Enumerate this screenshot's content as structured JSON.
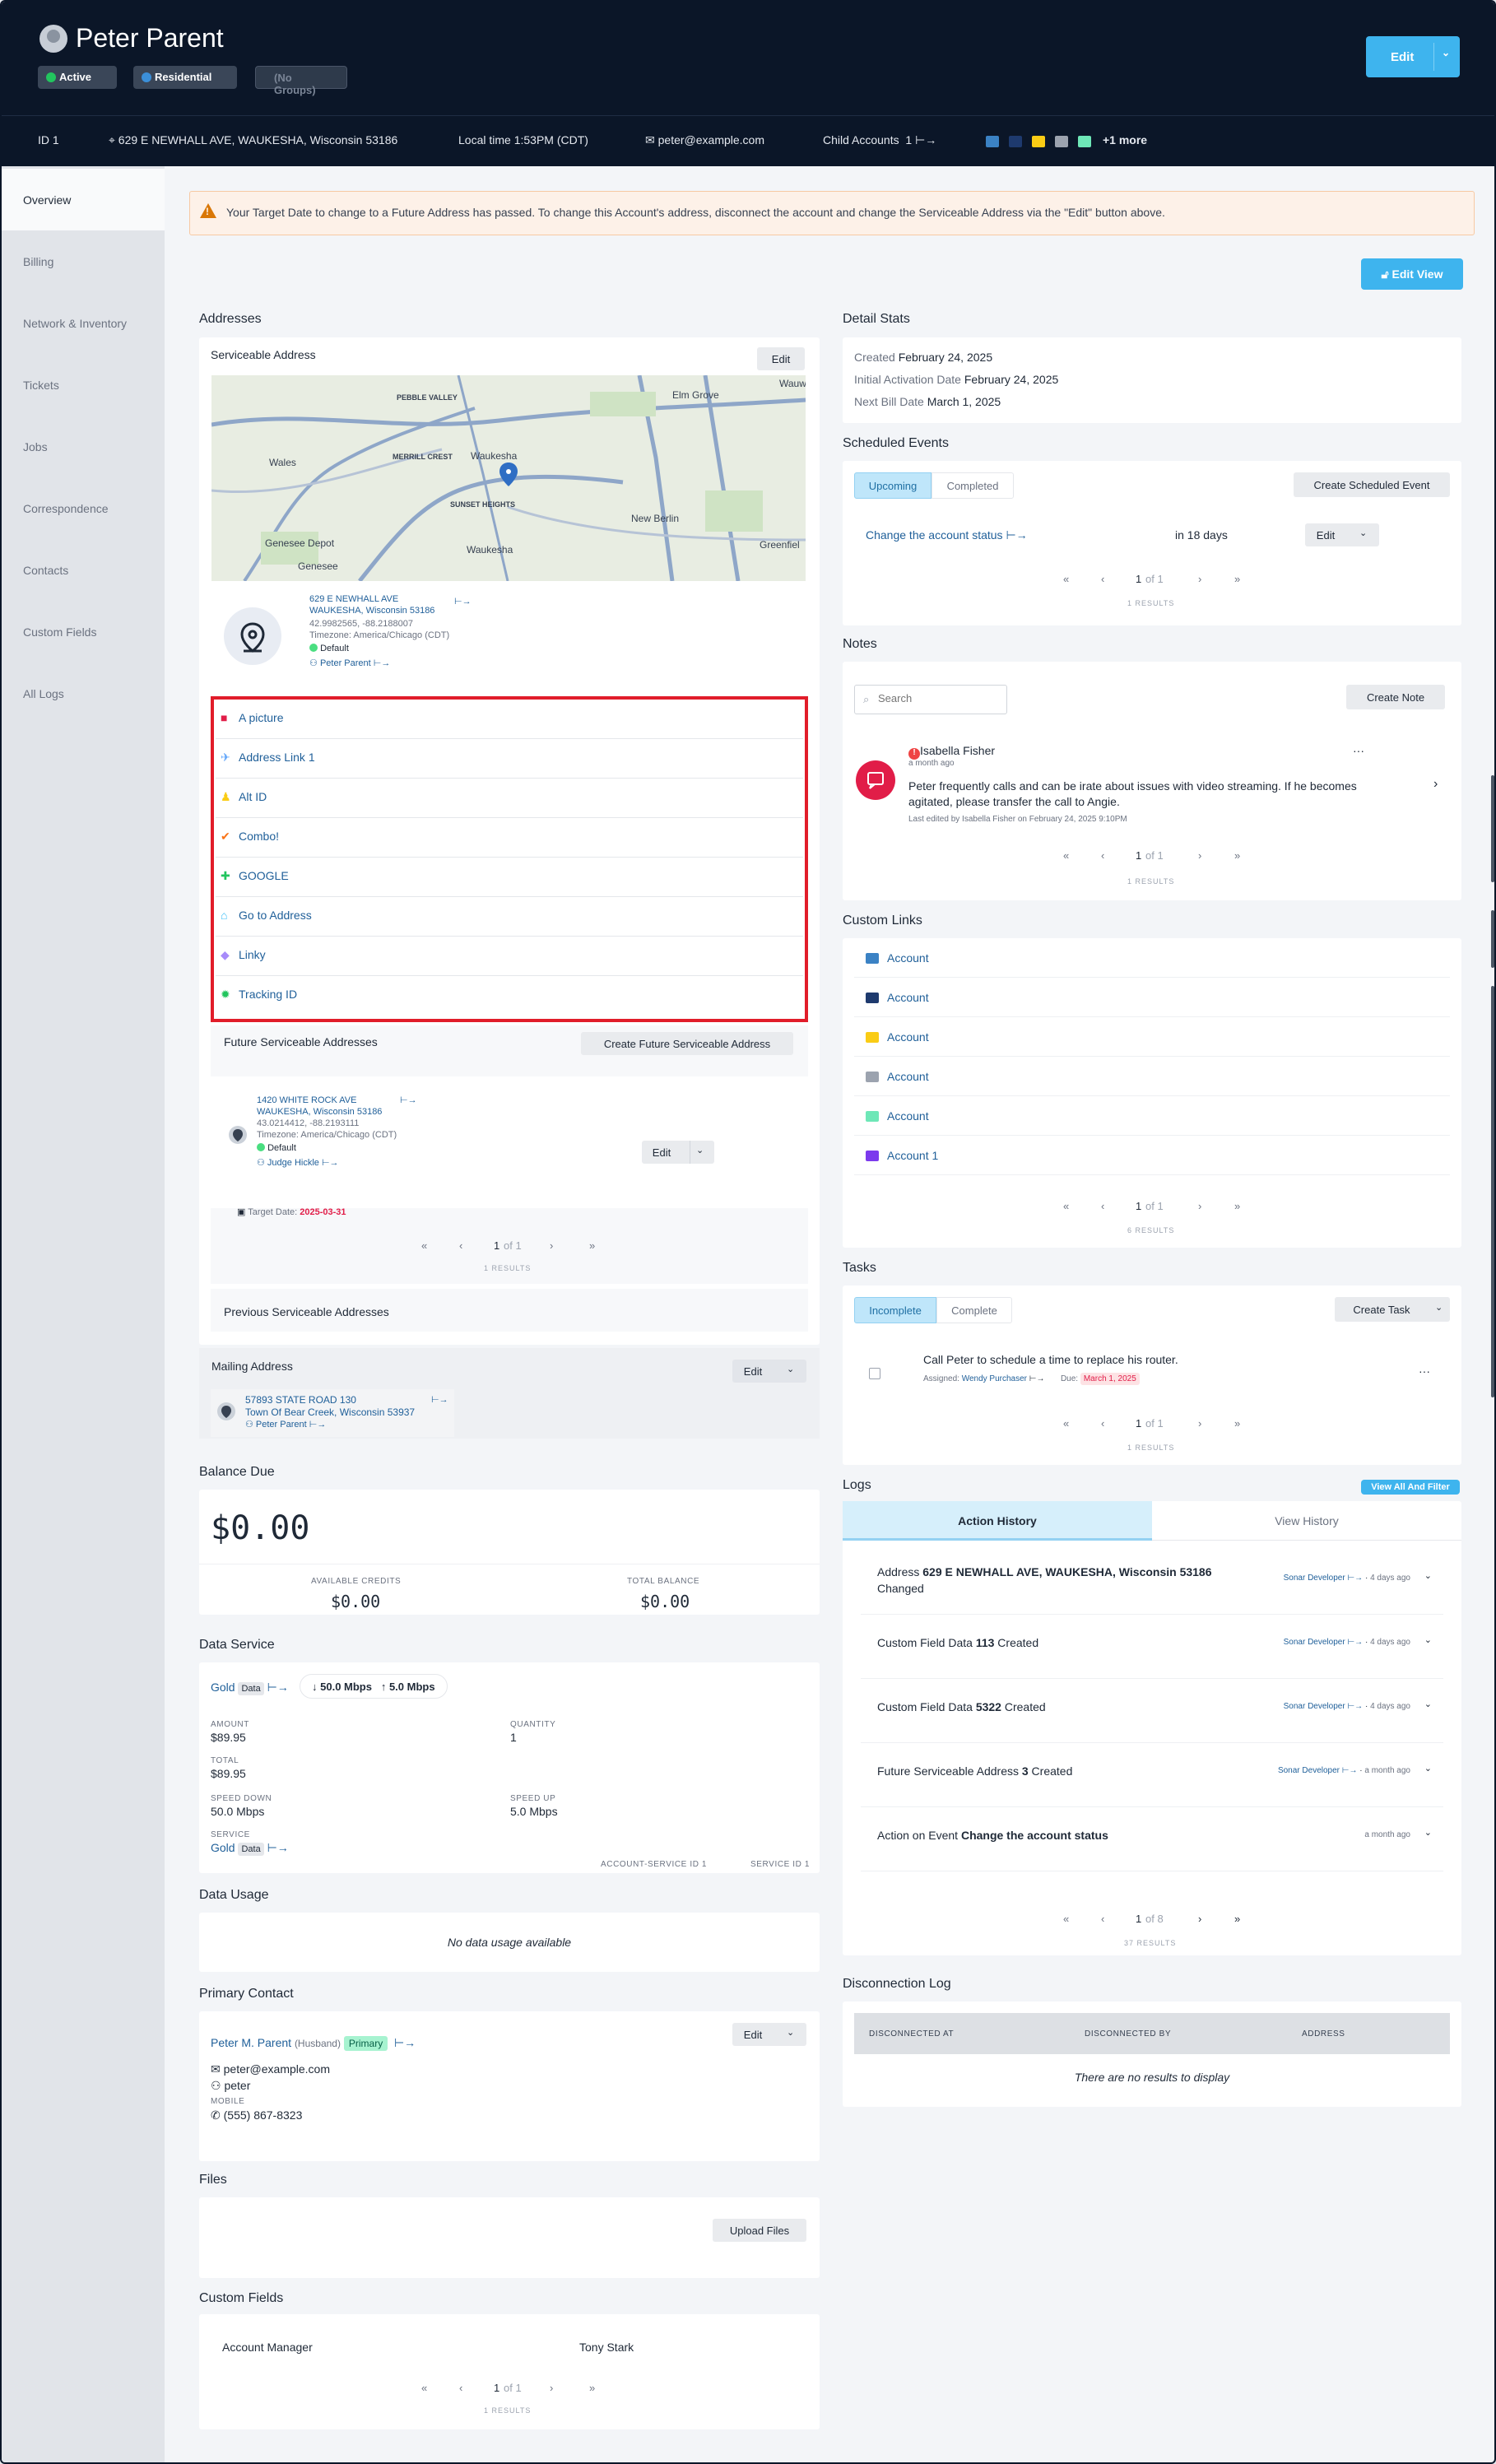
{
  "header": {
    "name": "Peter Parent",
    "pills": [
      "Active",
      "Residential",
      "(No Groups)"
    ],
    "edit_label": "Edit"
  },
  "infobar": {
    "id": "ID 1",
    "address": "629 E NEWHALL AVE, WAUKESHA, Wisconsin 53186",
    "local_time": "Local time 1:53PM (CDT)",
    "email": "peter@example.com",
    "child_accounts": "Child Accounts",
    "child_count": "1",
    "more": "+1 more"
  },
  "sidebar": {
    "items": [
      "Overview",
      "Billing",
      "Network & Inventory",
      "Tickets",
      "Jobs",
      "Correspondence",
      "Contacts",
      "Custom Fields",
      "All Logs"
    ]
  },
  "alert": {
    "text": "Your Target Date to change to a Future Address has passed. To change this Account's address, disconnect the account and change the Serviceable Address via the \"Edit\" button above."
  },
  "edit_view": "Edit View",
  "addresses": {
    "title": "Addresses",
    "serviceable": "Serviceable Address",
    "edit": "Edit",
    "map_labels": [
      "PEBBLE VALLEY",
      "Elm Grove",
      "Wauwat",
      "MERRILL CREST",
      "Waukesha",
      "Wales",
      "SUNSET HEIGHTS",
      "New Berlin",
      "Genesee Depot",
      "Waukesha",
      "Genesee",
      "Greenfiel"
    ],
    "line1": "629 E NEWHALL AVE",
    "line2": "WAUKESHA, Wisconsin 53186",
    "coords": "42.9982565, -88.2188007",
    "tz": "Timezone: America/Chicago (CDT)",
    "default": "Default",
    "contact": "Peter Parent",
    "links": [
      "A picture",
      "Address Link 1",
      "Alt ID",
      "Combo!",
      "GOOGLE",
      "Go to Address",
      "Linky",
      "Tracking ID"
    ],
    "future_title": "Future Serviceable Addresses",
    "create_future": "Create Future Serviceable Address",
    "future": {
      "line1": "1420 WHITE ROCK AVE",
      "line2": "WAUKESHA, Wisconsin 53186",
      "coords": "43.0214412, -88.2193111",
      "tz": "Timezone: America/Chicago (CDT)",
      "default": "Default",
      "contact": "Judge Hickle",
      "target_label": "Target Date:",
      "target": "2025-03-31",
      "edit": "Edit"
    },
    "pager": {
      "page": "1",
      "of": "of 1",
      "results": "1 RESULTS"
    },
    "previous": "Previous Serviceable Addresses",
    "mailing": "Mailing Address",
    "mailing_line1": "57893 STATE ROAD 130",
    "mailing_line2": "Town Of Bear Creek, Wisconsin 53937",
    "mailing_contact": "Peter Parent"
  },
  "balance": {
    "title": "Balance Due",
    "amount": "$0.00",
    "available_label": "AVAILABLE CREDITS",
    "available": "$0.00",
    "total_label": "TOTAL BALANCE",
    "total": "$0.00"
  },
  "data_service": {
    "title": "Data Service",
    "plan": "Gold",
    "tag": "Data",
    "down": "50.0 Mbps",
    "up": "5.0 Mbps",
    "amount_label": "AMOUNT",
    "amount": "$89.95",
    "qty_label": "QUANTITY",
    "qty": "1",
    "total_label": "TOTAL",
    "total": "$89.95",
    "sd_label": "SPEED DOWN",
    "sd": "50.0 Mbps",
    "su_label": "SPEED UP",
    "su": "5.0 Mbps",
    "service_label": "SERVICE",
    "service": "Gold",
    "acct_service_id": "ACCOUNT-SERVICE ID 1",
    "service_id": "SERVICE ID 1"
  },
  "data_usage": {
    "title": "Data Usage",
    "empty": "No data usage available"
  },
  "primary_contact": {
    "title": "Primary Contact",
    "name": "Peter M. Parent",
    "relation": "(Husband)",
    "badge": "Primary",
    "edit": "Edit",
    "email": "peter@example.com",
    "username": "peter",
    "mobile_label": "MOBILE",
    "mobile": "(555) 867-8323"
  },
  "files": {
    "title": "Files",
    "upload": "Upload Files"
  },
  "custom_fields": {
    "title": "Custom Fields",
    "key": "Account Manager",
    "value": "Tony Stark",
    "page": "1",
    "of": "of 1",
    "results": "1 RESULTS"
  },
  "detail_stats": {
    "title": "Detail Stats",
    "created_label": "Created",
    "created": "February 24, 2025",
    "activation_label": "Initial Activation Date",
    "activation": "February 24, 2025",
    "bill_label": "Next Bill Date",
    "bill": "March 1, 2025"
  },
  "scheduled": {
    "title": "Scheduled Events",
    "tabs": [
      "Upcoming",
      "Completed"
    ],
    "create": "Create Scheduled Event",
    "event": "Change the account status",
    "when": "in 18 days",
    "edit": "Edit",
    "page": "1",
    "of": "of 1",
    "results": "1 RESULTS"
  },
  "notes": {
    "title": "Notes",
    "search_placeholder": "Search",
    "create": "Create Note",
    "author": "Isabella Fisher",
    "time": "a month ago",
    "text1": "Peter frequently calls and can be irate about issues with video streaming. If he becomes",
    "text2": "agitated, please transfer the call to Angie.",
    "edited": "Last edited by Isabella Fisher on February 24, 2025 9:10PM",
    "page": "1",
    "of": "of 1",
    "results": "1 RESULTS"
  },
  "custom_links": {
    "title": "Custom Links",
    "items": [
      "Account",
      "Account",
      "Account",
      "Account",
      "Account",
      "Account 1"
    ],
    "page": "1",
    "of": "of 1",
    "results": "6 RESULTS"
  },
  "tasks": {
    "title": "Tasks",
    "tabs": [
      "Incomplete",
      "Complete"
    ],
    "create": "Create Task",
    "text": "Call Peter to schedule a time to replace his router.",
    "assigned_label": "Assigned:",
    "assigned": "Wendy Purchaser",
    "due_label": "Due:",
    "due": "March 1, 2025",
    "page": "1",
    "of": "of 1",
    "results": "1 RESULTS"
  },
  "logs": {
    "title": "Logs",
    "view_all": "View All And Filter",
    "tabs": [
      "Action History",
      "View History"
    ],
    "entries": [
      {
        "pre": "Address ",
        "bold": "629 E NEWHALL AVE, WAUKESHA, Wisconsin 53186",
        "post": "",
        "line2": "Changed",
        "who": "Sonar Developer",
        "when": "4 days ago"
      },
      {
        "pre": "Custom Field Data ",
        "bold": "113",
        "post": " Created",
        "line2": "",
        "who": "Sonar Developer",
        "when": "4 days ago"
      },
      {
        "pre": "Custom Field Data ",
        "bold": "5322",
        "post": " Created",
        "line2": "",
        "who": "Sonar Developer",
        "when": "4 days ago"
      },
      {
        "pre": "Future Serviceable Address ",
        "bold": "3",
        "post": " Created",
        "line2": "",
        "who": "Sonar Developer",
        "when": "a month ago"
      },
      {
        "pre": "Action on Event ",
        "bold": "Change the account status",
        "post": "",
        "line2": "",
        "who": "",
        "when": "a month ago"
      }
    ],
    "page": "1",
    "of": "of 8",
    "results": "37 RESULTS"
  },
  "disconnection": {
    "title": "Disconnection Log",
    "cols": [
      "DISCONNECTED AT",
      "DISCONNECTED BY",
      "ADDRESS"
    ],
    "empty": "There are no results to display"
  },
  "colors": {
    "accent": "#3eb4ee",
    "header": "#0b1628",
    "highlight": "#e11d2a",
    "link": "#1f5f99"
  }
}
